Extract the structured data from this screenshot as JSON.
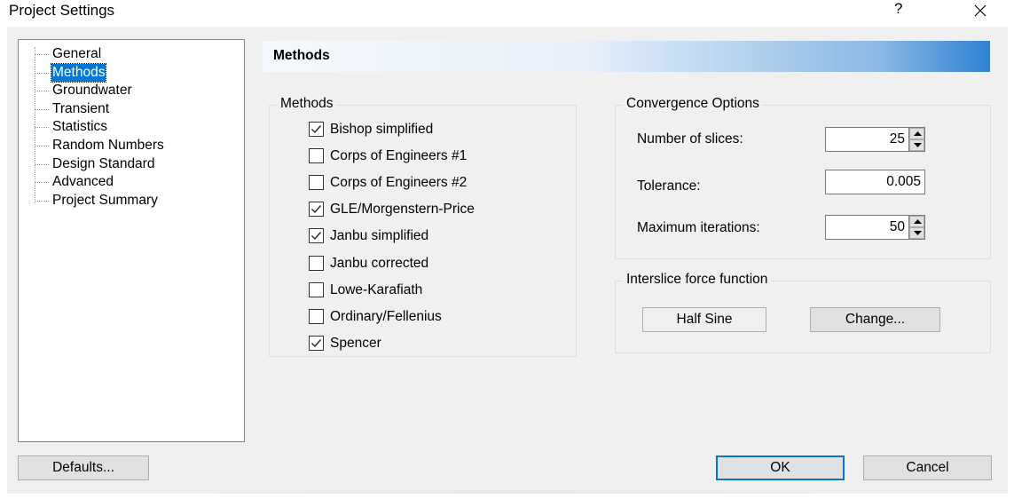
{
  "window": {
    "title": "Project Settings",
    "help_glyph": "?",
    "close_glyph": "✕"
  },
  "tree": {
    "items": [
      {
        "label": "General",
        "selected": false
      },
      {
        "label": "Methods",
        "selected": true
      },
      {
        "label": "Groundwater",
        "selected": false
      },
      {
        "label": "Transient",
        "selected": false
      },
      {
        "label": "Statistics",
        "selected": false
      },
      {
        "label": "Random Numbers",
        "selected": false
      },
      {
        "label": "Design Standard",
        "selected": false
      },
      {
        "label": "Advanced",
        "selected": false
      },
      {
        "label": "Project Summary",
        "selected": false
      }
    ]
  },
  "banner": {
    "title": "Methods"
  },
  "methods_group": {
    "title": "Methods",
    "options": [
      {
        "label": "Bishop simplified",
        "checked": true
      },
      {
        "label": "Corps of Engineers #1",
        "checked": false
      },
      {
        "label": "Corps of Engineers #2",
        "checked": false
      },
      {
        "label": "GLE/Morgenstern-Price",
        "checked": true
      },
      {
        "label": "Janbu simplified",
        "checked": true
      },
      {
        "label": "Janbu corrected",
        "checked": false
      },
      {
        "label": "Lowe-Karafiath",
        "checked": false
      },
      {
        "label": "Ordinary/Fellenius",
        "checked": false
      },
      {
        "label": "Spencer",
        "checked": true
      }
    ]
  },
  "convergence": {
    "title": "Convergence Options",
    "slices_label": "Number of slices:",
    "slices_value": "25",
    "tolerance_label": "Tolerance:",
    "tolerance_value": "0.005",
    "iterations_label": "Maximum iterations:",
    "iterations_value": "50"
  },
  "interslice": {
    "title": "Interslice force function",
    "function_value": "Half Sine",
    "change_label": "Change..."
  },
  "footer": {
    "defaults_label": "Defaults...",
    "ok_label": "OK",
    "cancel_label": "Cancel"
  },
  "colors": {
    "selection": "#0078d7",
    "banner_end": "#2f82d3",
    "dialog_bg": "#f0f0f0"
  }
}
